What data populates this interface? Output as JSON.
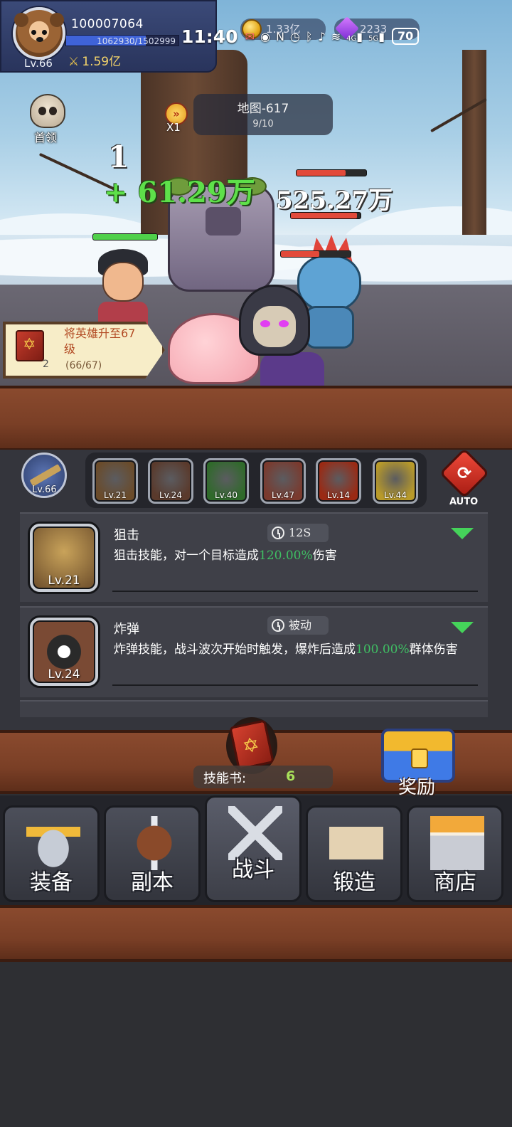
{
  "status_bar": {
    "time": "11:40",
    "icons": [
      "notification-icon",
      "eye-icon",
      "nfc-icon",
      "alarm-icon",
      "bluetooth-icon",
      "mute-icon",
      "wifi-icon",
      "signal-4g-icon",
      "signal-5g-icon"
    ],
    "net_4g": "4G",
    "net_5g": "5G",
    "battery": "70"
  },
  "player": {
    "id": "100007064",
    "level": "Lv.66",
    "xp_text": "1062930/1502999",
    "xp_fraction": 0.707,
    "power": "1.59亿"
  },
  "currency": {
    "gold": "1.33亿",
    "gems": "2233"
  },
  "battle": {
    "boss_label": "首领",
    "speed_label": "X1",
    "map_title": "地图-617",
    "map_progress": "9/10",
    "hit_number": "1",
    "heal_number": "+ 61.29万",
    "damage_number": "525.27万",
    "hero_hp": 1.0,
    "enemy_hp_bars": [
      0.7,
      0.95,
      0.55
    ]
  },
  "quest": {
    "text": "将英雄升至67级",
    "item_count": "2",
    "progress": "(66/67)"
  },
  "skill_bar": {
    "weapon_level": "Lv.66",
    "skills": [
      {
        "name": "sniper-skill",
        "level": "Lv.21",
        "color": "#6a4b2a"
      },
      {
        "name": "bomb-skill",
        "level": "Lv.24",
        "color": "#5a3a2c"
      },
      {
        "name": "poison-skill",
        "level": "Lv.40",
        "color": "#2f6a2a"
      },
      {
        "name": "fire-orb-skill",
        "level": "Lv.47",
        "color": "#7a3a2e"
      },
      {
        "name": "explosion-skill",
        "level": "Lv.14",
        "color": "#9a2a14"
      },
      {
        "name": "lightning-skill",
        "level": "Lv.44",
        "color": "#b89a2a"
      }
    ],
    "auto_label": "AUTO"
  },
  "skill_cards": [
    {
      "name": "狙击",
      "cooldown": "12S",
      "level": "Lv.21",
      "desc_before": "狙击技能，对一个目标造成",
      "desc_value": "120.00%",
      "desc_after": "伤害"
    },
    {
      "name": "炸弹",
      "cooldown": "被动",
      "level": "Lv.24",
      "desc_before": "炸弹技能，战斗波次开始时触发，爆炸后造成",
      "desc_value": "100.00%",
      "desc_after": "群体伤害"
    }
  ],
  "skill_book": {
    "label": "技能书:",
    "count": "6"
  },
  "reward": {
    "label": "奖励"
  },
  "nav": {
    "equipment": "装备",
    "dungeon": "副本",
    "battle": "战斗",
    "forge": "锻造",
    "shop": "商店"
  },
  "colors": {
    "accent_green": "#3fbf63",
    "heal_green": "#5ee04a",
    "wood": "#7a3f26",
    "panel": "#34353c"
  }
}
